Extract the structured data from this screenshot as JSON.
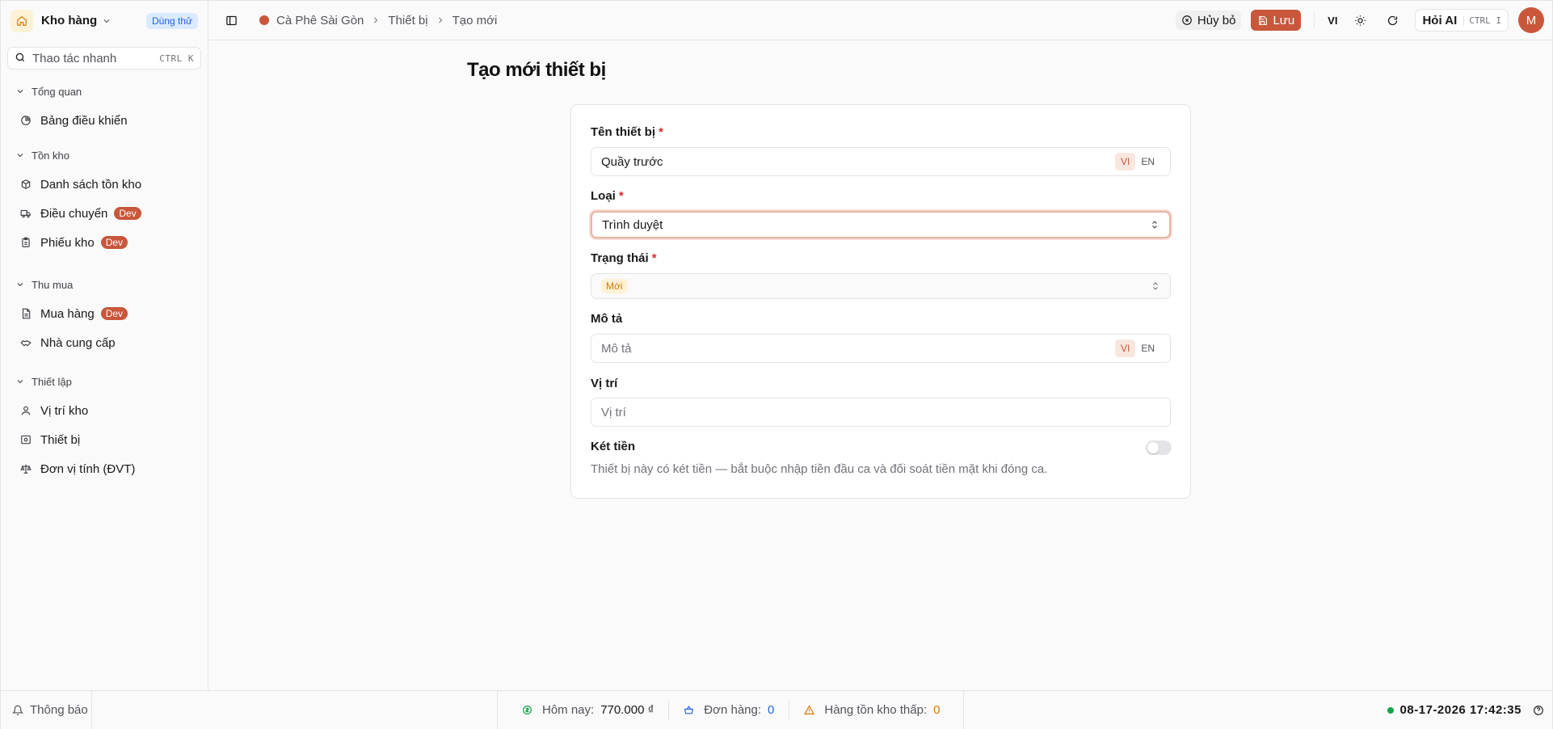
{
  "sidebar": {
    "store_name": "Kho hàng",
    "trial_badge": "Dùng thử",
    "quick_action": {
      "label": "Thao tác nhanh",
      "shortcut": "CTRL K"
    },
    "groups": [
      {
        "label": "Tổng quan",
        "items": [
          {
            "label": "Bảng điều khiển",
            "icon": "pie-chart-icon"
          }
        ]
      },
      {
        "label": "Tồn kho",
        "items": [
          {
            "label": "Danh sách tồn kho",
            "icon": "boxes-icon"
          },
          {
            "label": "Điều chuyển",
            "icon": "truck-icon",
            "badge": "Dev"
          },
          {
            "label": "Phiếu kho",
            "icon": "clipboard-icon",
            "badge": "Dev"
          }
        ]
      },
      {
        "label": "Thu mua",
        "items": [
          {
            "label": "Mua hàng",
            "icon": "file-icon",
            "badge": "Dev"
          },
          {
            "label": "Nhà cung cấp",
            "icon": "handshake-icon"
          }
        ]
      },
      {
        "label": "Thiết lập",
        "items": [
          {
            "label": "Vị trí kho",
            "icon": "map-pin-icon"
          },
          {
            "label": "Thiết bị",
            "icon": "device-icon"
          },
          {
            "label": "Đơn vị tính (ĐVT)",
            "icon": "scale-icon"
          }
        ]
      }
    ]
  },
  "topbar": {
    "breadcrumb": [
      "Cà Phê Sài Gòn",
      "Thiết bị",
      "Tạo mới"
    ],
    "cancel_label": "Hủy bỏ",
    "save_label": "Lưu",
    "language": "VI",
    "ask_ai": {
      "label": "Hỏi AI",
      "shortcut": "CTRL I"
    },
    "avatar_initial": "M"
  },
  "page": {
    "title": "Tạo mới thiết bị",
    "form": {
      "name": {
        "label": "Tên thiết bị",
        "value": "Quầy trước",
        "lang_vi": "VI",
        "lang_en": "EN"
      },
      "type": {
        "label": "Loại",
        "value": "Trình duyệt"
      },
      "status": {
        "label": "Trạng thái",
        "value": "Mới"
      },
      "description": {
        "label": "Mô tả",
        "placeholder": "Mô tả",
        "lang_vi": "VI",
        "lang_en": "EN"
      },
      "location": {
        "label": "Vị trí",
        "placeholder": "Vị trí"
      },
      "cash_drawer": {
        "label": "Két tiền",
        "enabled": false,
        "help": "Thiết bị này có két tiền — bắt buộc nhập tiền đầu ca và đối soát tiền mặt khi đóng ca."
      }
    }
  },
  "footer": {
    "notifications": "Thông báo",
    "today": {
      "label": "Hôm nay:",
      "value": "770.000 ₫"
    },
    "orders": {
      "label": "Đơn hàng:",
      "value": "0"
    },
    "low_stock": {
      "label": "Hàng tồn kho thấp:",
      "value": "0"
    },
    "datetime": "08-17-2026 17:42:35"
  },
  "colors": {
    "accent": "#c8573b",
    "link": "#2563eb",
    "warning": "#d97706",
    "online": "#16a34a"
  }
}
